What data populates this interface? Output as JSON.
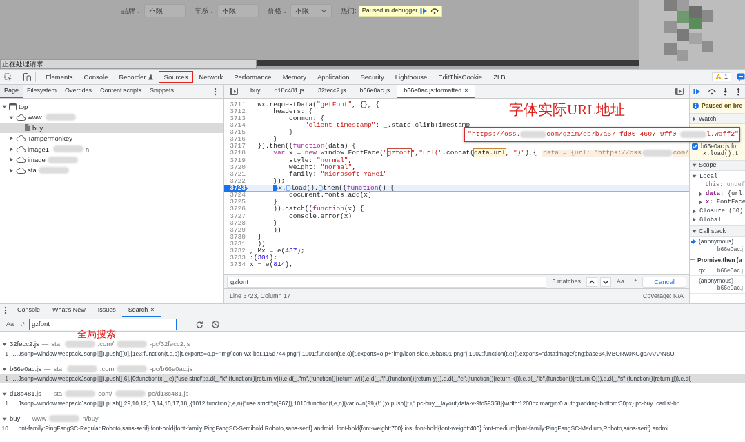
{
  "page": {
    "filters": [
      {
        "label": "品牌：",
        "value": "不限",
        "kind": "text"
      },
      {
        "label": "车系：",
        "value": "不限",
        "kind": "text"
      },
      {
        "label": "价格：",
        "value": "不限",
        "kind": "select"
      }
    ],
    "hot_label": "热门:",
    "paused_badge": "Paused in debugger",
    "status": "正在处理请求..."
  },
  "devtools_tabs": [
    {
      "label": "Elements",
      "outlined": false
    },
    {
      "label": "Console",
      "outlined": false
    },
    {
      "label": "Recorder",
      "outlined": false,
      "experimental": true
    },
    {
      "label": "Sources",
      "outlined": true
    },
    {
      "label": "Network",
      "outlined": false
    },
    {
      "label": "Performance",
      "outlined": false
    },
    {
      "label": "Memory",
      "outlined": false
    },
    {
      "label": "Application",
      "outlined": false
    },
    {
      "label": "Security",
      "outlined": false
    },
    {
      "label": "Lighthouse",
      "outlined": false
    },
    {
      "label": "EditThisCookie",
      "outlined": false
    },
    {
      "label": "ZLB",
      "outlined": false
    }
  ],
  "issues_count": "1",
  "navigator": {
    "tabs": [
      {
        "label": "Page",
        "selected": true
      },
      {
        "label": "Filesystem",
        "selected": false
      },
      {
        "label": "Overrides",
        "selected": false
      },
      {
        "label": "Content scripts",
        "selected": false
      },
      {
        "label": "Snippets",
        "selected": false
      }
    ],
    "tree": [
      {
        "kind": "frame",
        "label": "top",
        "expanded": true,
        "selected": false,
        "children": [
          {
            "kind": "domain",
            "label": "www.",
            "redacted": true,
            "expanded": true,
            "selected": false,
            "children": [
              {
                "kind": "file",
                "label": "buy",
                "selected": true
              }
            ]
          },
          {
            "kind": "domain",
            "label": "Tampermonkey",
            "redacted": false,
            "expanded": false,
            "selected": false
          },
          {
            "kind": "domain",
            "label": "image1.",
            "redacted": true,
            "label_end": "n",
            "expanded": false,
            "selected": false
          },
          {
            "kind": "domain",
            "label": "image",
            "redacted": true,
            "expanded": false,
            "selected": false
          },
          {
            "kind": "domain",
            "label": "sta",
            "redacted": true,
            "expanded": false,
            "selected": false
          }
        ]
      }
    ]
  },
  "editor": {
    "tabs": [
      {
        "label": "buy",
        "selected": false,
        "closable": false
      },
      {
        "label": "d18c481.js",
        "selected": false,
        "closable": false
      },
      {
        "label": "32fecc2.js",
        "selected": false,
        "closable": false
      },
      {
        "label": "b66e0ac.js",
        "selected": false,
        "closable": false
      },
      {
        "label": "b66e0ac.js:formatted",
        "selected": true,
        "closable": true,
        "close": "×"
      }
    ],
    "annotation": "字体实际URL地址",
    "lines": [
      {
        "number": "3711",
        "current": false,
        "code": [
          {
            "text": "  wx.requestData(",
            "kind": "plain"
          },
          {
            "text": "\"getFont\"",
            "kind": "string"
          },
          {
            "text": ", {}, {",
            "kind": "plain"
          }
        ]
      },
      {
        "number": "3712",
        "current": false,
        "code": [
          {
            "text": "      headers: {",
            "kind": "plain"
          }
        ]
      },
      {
        "number": "3713",
        "current": false,
        "code": [
          {
            "text": "          common: {",
            "kind": "plain"
          }
        ]
      },
      {
        "number": "3714",
        "current": false,
        "code": [
          {
            "text": "              \"client-timestamp\"",
            "kind": "string"
          },
          {
            "text": ": _.state.climbTimestamp",
            "kind": "plain"
          }
        ]
      },
      {
        "number": "3715",
        "current": false,
        "code": [
          {
            "text": "          }",
            "kind": "plain"
          }
        ]
      },
      {
        "number": "3716",
        "current": false,
        "code": [
          {
            "text": "      }",
            "kind": "plain"
          }
        ]
      },
      {
        "number": "3717",
        "current": false,
        "code": [
          {
            "text": "  }).then((",
            "kind": "plain"
          },
          {
            "text": "function",
            "kind": "keyword"
          },
          {
            "text": "(data) {",
            "kind": "plain"
          }
        ]
      },
      {
        "number": "3718",
        "current": false,
        "code": [
          {
            "text": "      var",
            "kind": "keyword"
          },
          {
            "text": " x = ",
            "kind": "plain"
          },
          {
            "text": "new",
            "kind": "keyword"
          },
          {
            "text": " window.FontFace(",
            "kind": "plain"
          },
          {
            "text": "\"",
            "kind": "string"
          },
          {
            "text": "gzfont",
            "kind": "match"
          },
          {
            "text": "\"",
            "kind": "string"
          },
          {
            "text": ",",
            "kind": "plain"
          },
          {
            "text": "\"url(\"",
            "kind": "string"
          },
          {
            "text": ".concat(",
            "kind": "plain"
          },
          {
            "text": "data.url",
            "kind": "inspected"
          },
          {
            "text": ", ",
            "kind": "plain"
          },
          {
            "text": "\")\"",
            "kind": "string"
          },
          {
            "text": "),{",
            "kind": "plain"
          }
        ],
        "hint": [
          "data = {url: 'https://oss",
          "com/"
        ]
      },
      {
        "number": "3719",
        "current": false,
        "code": [
          {
            "text": "          style: ",
            "kind": "plain"
          },
          {
            "text": "\"normal\"",
            "kind": "string"
          },
          {
            "text": ",",
            "kind": "plain"
          }
        ]
      },
      {
        "number": "3720",
        "current": false,
        "code": [
          {
            "text": "          weight: ",
            "kind": "plain"
          },
          {
            "text": "\"normal\"",
            "kind": "string"
          },
          {
            "text": ",",
            "kind": "plain"
          }
        ]
      },
      {
        "number": "3721",
        "current": false,
        "code": [
          {
            "text": "          family: ",
            "kind": "plain"
          },
          {
            "text": "\"Microsoft YaHei\"",
            "kind": "string"
          }
        ]
      },
      {
        "number": "3722",
        "current": false,
        "code": [
          {
            "text": "      });",
            "kind": "plain"
          }
        ]
      },
      {
        "number": "3723",
        "current": true,
        "code": [
          {
            "text": "      x.",
            "kind": "plain",
            "breakpoint": true,
            "active": true
          },
          {
            "text": "load().",
            "kind": "plain",
            "breakpoint": true,
            "active": false
          },
          {
            "text": "then((",
            "kind": "plain",
            "breakpoint": true,
            "active": false
          },
          {
            "text": "function",
            "kind": "keyword"
          },
          {
            "text": "() {",
            "kind": "plain"
          }
        ]
      },
      {
        "number": "3724",
        "current": false,
        "code": [
          {
            "text": "          document.fonts.add(x)",
            "kind": "plain"
          }
        ]
      },
      {
        "number": "3725",
        "current": false,
        "code": [
          {
            "text": "      }",
            "kind": "plain"
          }
        ]
      },
      {
        "number": "3726",
        "current": false,
        "code": [
          {
            "text": "      )).catch((",
            "kind": "plain"
          },
          {
            "text": "function",
            "kind": "keyword"
          },
          {
            "text": "(x) {",
            "kind": "plain"
          }
        ]
      },
      {
        "number": "3727",
        "current": false,
        "code": [
          {
            "text": "          console.error(x)",
            "kind": "plain"
          }
        ]
      },
      {
        "number": "3728",
        "current": false,
        "code": [
          {
            "text": "      }",
            "kind": "plain"
          }
        ]
      },
      {
        "number": "3729",
        "current": false,
        "code": [
          {
            "text": "      ))",
            "kind": "plain"
          }
        ]
      },
      {
        "number": "3730",
        "current": false,
        "code": [
          {
            "text": "  }",
            "kind": "plain"
          }
        ]
      },
      {
        "number": "3731",
        "current": false,
        "code": [
          {
            "text": "  ))",
            "kind": "plain"
          }
        ]
      },
      {
        "number": "3732",
        "current": false,
        "code": [
          {
            "text": ", Mx = e(",
            "kind": "plain"
          },
          {
            "text": "437",
            "kind": "number"
          },
          {
            "text": ");",
            "kind": "plain"
          }
        ]
      },
      {
        "number": "3733",
        "current": false,
        "code": [
          {
            "text": ":(",
            "kind": "plain"
          },
          {
            "text": "301",
            "kind": "number"
          },
          {
            "text": ");",
            "kind": "plain"
          }
        ]
      },
      {
        "number": "3734",
        "current": false,
        "code": [
          {
            "text": "x = e(",
            "kind": "plain"
          },
          {
            "text": "814",
            "kind": "number"
          },
          {
            "text": "),",
            "kind": "plain"
          }
        ]
      }
    ],
    "tooltip": [
      "\"https://oss.",
      "com/gzim/eb7b7a67-fd00-4607-9ff0-",
      "l.woff2\""
    ],
    "search": {
      "value": "gzfont",
      "matches": "3 matches",
      "case": "Aa",
      "regex": ".*",
      "cancel": "Cancel"
    },
    "status": {
      "position": "Line 3723, Column 17",
      "coverage": "Coverage: N/A"
    }
  },
  "debugger": {
    "paused": "Paused on bre",
    "watch": {
      "title": "Watch",
      "expanded": false
    },
    "breakpoint": {
      "checked": true,
      "file": "b66e0ac.js:fo",
      "code": "x.load().t"
    },
    "scope": {
      "title": "Scope",
      "expanded": true,
      "items": [
        {
          "label": "Local",
          "expanded": true,
          "children": [
            {
              "kind": "property",
              "name": "this:",
              "value": "undef"
            },
            {
              "kind": "object",
              "name": "data:",
              "value": "{url:",
              "expanded": false
            },
            {
              "kind": "object",
              "name": "x:",
              "value": "FontFace",
              "expanded": false
            }
          ]
        },
        {
          "label": "Closure (80)",
          "expanded": false
        },
        {
          "label": "Global",
          "expanded": false
        }
      ]
    },
    "call_stack": {
      "title": "Call stack",
      "expanded": true,
      "frames": [
        {
          "kind": "frame",
          "function": "(anonymous)",
          "location": "b66e0ac.j",
          "current": true
        },
        {
          "kind": "async",
          "function": "Promise.then (a"
        },
        {
          "kind": "frame",
          "function": "qx",
          "location": "b66e0ac.j",
          "current": false
        },
        {
          "kind": "frame",
          "function": "(anonymous)",
          "location": "b66e0ac.j",
          "current": false
        }
      ]
    }
  },
  "drawer": {
    "tabs": [
      {
        "label": "Console",
        "selected": false,
        "closable": false
      },
      {
        "label": "What's New",
        "selected": false,
        "closable": false
      },
      {
        "label": "Issues",
        "selected": false,
        "closable": false
      },
      {
        "label": "Search",
        "selected": true,
        "closable": true,
        "close": "×"
      }
    ],
    "case": "Aa",
    "regex": ".*",
    "query": "gzfont",
    "annotation": "全局搜索",
    "results": [
      {
        "file": "32fecc2.js",
        "separator": "—",
        "expanded": true,
        "url": [
          "sta.",
          ".com/",
          "-pc/32fecc2.js"
        ],
        "lines": [
          {
            "number": "1",
            "selected": false,
            "text": "…Jsonp=window.webpackJsonp||[]).push([[0],{1e3:function(t,e,o){t.exports=o.p+\"img/icon-wx-bar.115d744.png\"},1001:function(t,e,o){t.exports=o.p+\"img/icon-side.06ba801.png\"},1002:function(t,e){t.exports=\"data:image/png;base64,iVBORw0KGgoAAAANSU"
          }
        ]
      },
      {
        "file": "b66e0ac.js",
        "separator": "—",
        "expanded": true,
        "url": [
          "sta.",
          ".com",
          "-pc/b66e0ac.js"
        ],
        "lines": [
          {
            "number": "1",
            "selected": true,
            "text": "…Jsonp=window.webpackJsonp||[]).push([[6],{0:function(x,_,e){\"use strict\";e.d(_,\"k\",(function(){return v})),e.d(_,\"m\",(function(){return w})),e.d(_,\"l\",(function(){return y})),e.d(_,\"e\",(function(){return k})),e.d(_,\"b\",(function(){return O})),e.d(_,\"s\",(function(){return j})),e.d("
          }
        ]
      },
      {
        "file": "d18c481.js",
        "separator": "—",
        "expanded": true,
        "url": [
          "sta",
          "com/",
          "pc/d18c481.js"
        ],
        "lines": [
          {
            "number": "1",
            "selected": false,
            "text": "…Jsonp=window.webpackJsonp||[]).push([[29,10,12,13,14,15,17,18],{1012:function(t,e,n){\"use strict\";n(967)},1013:function(t,e,n){var o=n(99)(!1);o.push([t.i,\".pc-buy__layout[data-v-9fd59358]{width:1200px;margin:0 auto;padding-bottom:30px}.pc-buy .carlist-bo"
          }
        ]
      },
      {
        "file": "buy",
        "separator": "—",
        "expanded": true,
        "url": [
          "www",
          "n/buy"
        ],
        "lines": [
          {
            "number": "10",
            "selected": false,
            "text": "…ont-family:PingFangSC-Regular,Roboto,sans-serif}.font-bold{font-family:PingFangSC-Semibold,Roboto,sans-serif}.android .font-bold{font-weight:700}.ios .font-bold{font-weight:400}.font-medium{font-family:PingFangSC-Medium,Roboto,sans-serif}.androi"
          }
        ]
      }
    ]
  }
}
